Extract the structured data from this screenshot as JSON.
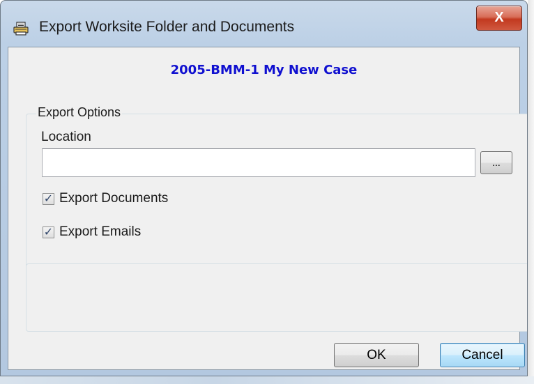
{
  "window": {
    "title": "Export Worksite Folder and Documents",
    "close_label": "X"
  },
  "case_title": "2005-BMM-1 My New Case",
  "export_options": {
    "legend": "Export Options",
    "location_label": "Location",
    "location_value": "",
    "browse_label": "...",
    "export_documents_label": "Export Documents",
    "export_documents_checked": true,
    "export_emails_label": "Export Emails",
    "export_emails_checked": true
  },
  "buttons": {
    "ok_label": "OK",
    "cancel_label": "Cancel"
  },
  "colors": {
    "case_title": "#1010d0",
    "close_button": "#c2391f",
    "default_button_border": "#3c7fb1"
  }
}
